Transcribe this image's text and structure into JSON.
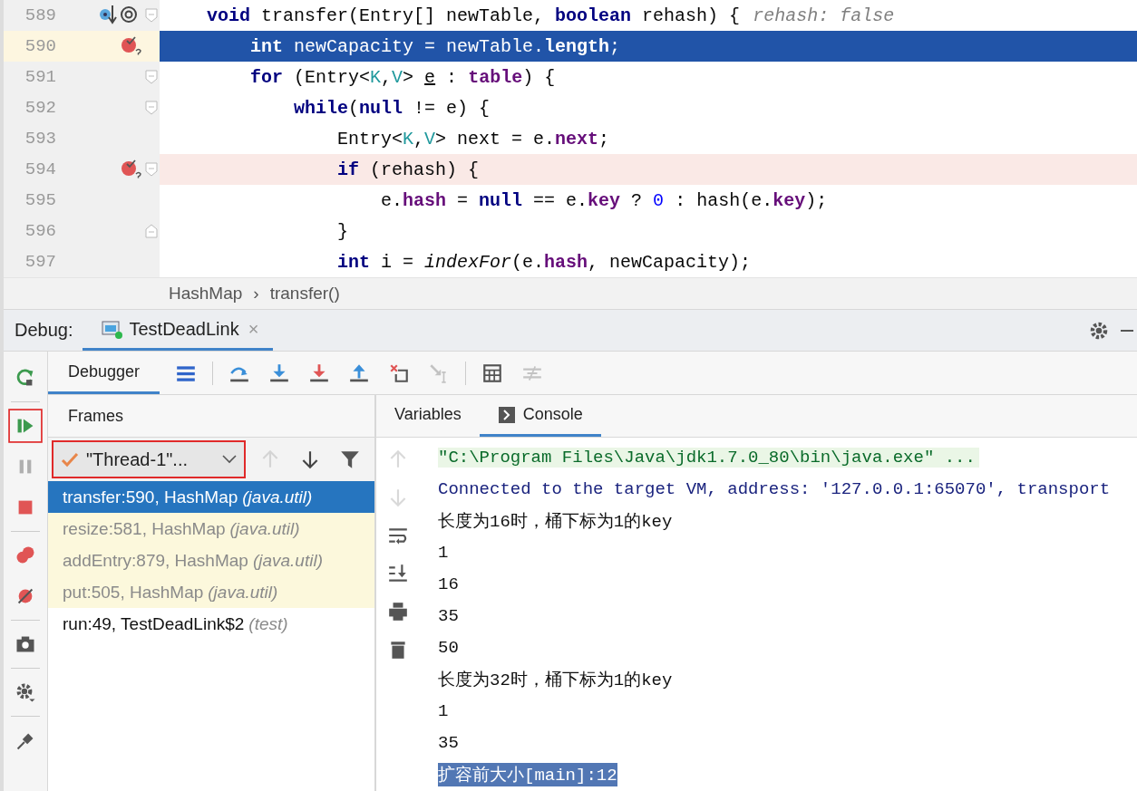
{
  "editor": {
    "lines": [
      {
        "number": "589",
        "kind": "plain",
        "breakpoint": false,
        "method_breakpoint": true,
        "fold_start": true,
        "fold_end": false,
        "tokens": [
          {
            "kind": "kw",
            "t": "void"
          },
          {
            "kind": "p",
            "t": " transfer(Entry[] newTable, "
          },
          {
            "kind": "kw",
            "t": "boolean"
          },
          {
            "kind": "p",
            "t": " rehash) {"
          },
          {
            "kind": "hint",
            "t": "rehash: false"
          }
        ],
        "children": [
          {
            "number": "590",
            "kind": "current",
            "breakpoint": true,
            "method_breakpoint": false,
            "fold_start": false,
            "fold_end": false,
            "tokens": [
              {
                "kind": "kw",
                "t": "int"
              },
              {
                "kind": "p",
                "t": " newCapacity = newTable."
              },
              {
                "kind": "fld",
                "t": "length"
              },
              {
                "kind": "p",
                "t": ";"
              }
            ]
          },
          {
            "number": "591",
            "kind": "plain",
            "breakpoint": false,
            "method_breakpoint": false,
            "fold_start": true,
            "fold_end": false,
            "tokens": [
              {
                "kind": "kw",
                "t": "for"
              },
              {
                "kind": "p",
                "t": " (Entry<"
              },
              {
                "kind": "tp",
                "t": "K"
              },
              {
                "kind": "p",
                "t": ","
              },
              {
                "kind": "tp",
                "t": "V"
              },
              {
                "kind": "p",
                "t": "> "
              },
              {
                "kind": "ul",
                "t": "e"
              },
              {
                "kind": "p",
                "t": " : "
              },
              {
                "kind": "fld",
                "t": "table"
              },
              {
                "kind": "p",
                "t": ") {"
              }
            ],
            "children": [
              {
                "number": "592",
                "kind": "plain",
                "breakpoint": false,
                "method_breakpoint": false,
                "fold_start": true,
                "fold_end": false,
                "tokens": [
                  {
                    "kind": "kw",
                    "t": "while"
                  },
                  {
                    "kind": "p",
                    "t": "("
                  },
                  {
                    "kind": "kw",
                    "t": "null"
                  },
                  {
                    "kind": "p",
                    "t": " != e) {"
                  }
                ],
                "children": [
                  {
                    "number": "593",
                    "kind": "plain",
                    "breakpoint": false,
                    "method_breakpoint": false,
                    "fold_start": false,
                    "fold_end": false,
                    "tokens": [
                      {
                        "kind": "p",
                        "t": "Entry<"
                      },
                      {
                        "kind": "tp",
                        "t": "K"
                      },
                      {
                        "kind": "p",
                        "t": ","
                      },
                      {
                        "kind": "tp",
                        "t": "V"
                      },
                      {
                        "kind": "p",
                        "t": "> next = e."
                      },
                      {
                        "kind": "fld",
                        "t": "next"
                      },
                      {
                        "kind": "p",
                        "t": ";"
                      }
                    ]
                  },
                  {
                    "number": "594",
                    "kind": "breakpoint",
                    "breakpoint": true,
                    "method_breakpoint": false,
                    "fold_start": true,
                    "fold_end": false,
                    "tokens": [
                      {
                        "kind": "kw",
                        "t": "if"
                      },
                      {
                        "kind": "p",
                        "t": " (rehash) {"
                      }
                    ],
                    "children": [
                      {
                        "number": "595",
                        "kind": "plain",
                        "breakpoint": false,
                        "method_breakpoint": false,
                        "fold_start": false,
                        "fold_end": false,
                        "tokens": [
                          {
                            "kind": "p",
                            "t": "e."
                          },
                          {
                            "kind": "fld",
                            "t": "hash"
                          },
                          {
                            "kind": "p",
                            "t": " = "
                          },
                          {
                            "kind": "kw",
                            "t": "null"
                          },
                          {
                            "kind": "p",
                            "t": " == e."
                          },
                          {
                            "kind": "fld",
                            "t": "key"
                          },
                          {
                            "kind": "p",
                            "t": " ? "
                          },
                          {
                            "kind": "num",
                            "t": "0"
                          },
                          {
                            "kind": "p",
                            "t": " : hash(e."
                          },
                          {
                            "kind": "fld",
                            "t": "key"
                          },
                          {
                            "kind": "p",
                            "t": ");"
                          }
                        ]
                      }
                    ]
                  },
                  {
                    "number": "596",
                    "kind": "plain",
                    "breakpoint": false,
                    "method_breakpoint": false,
                    "fold_start": false,
                    "fold_end": true,
                    "tokens": [
                      {
                        "kind": "p",
                        "t": "}"
                      }
                    ]
                  },
                  {
                    "number": "597",
                    "kind": "plain",
                    "breakpoint": false,
                    "method_breakpoint": false,
                    "fold_start": false,
                    "fold_end": false,
                    "tokens": [
                      {
                        "kind": "kw",
                        "t": "int"
                      },
                      {
                        "kind": "p",
                        "t": " i = "
                      },
                      {
                        "kind": "it",
                        "t": "indexFor"
                      },
                      {
                        "kind": "p",
                        "t": "(e."
                      },
                      {
                        "kind": "fld",
                        "t": "hash"
                      },
                      {
                        "kind": "p",
                        "t": ", newCapacity);"
                      }
                    ]
                  }
                ]
              }
            ]
          }
        ]
      }
    ]
  },
  "breadcrumb": [
    "HashMap",
    "›",
    "transfer()"
  ],
  "debug": {
    "label": "Debug:",
    "tab": {
      "title": "TestDeadLink",
      "close": "×"
    }
  },
  "side_toolbar": [
    {
      "kind": "rerun",
      "disabled": false,
      "marked": false
    },
    {
      "kind": "resume",
      "disabled": false,
      "marked": true
    },
    {
      "kind": "pause",
      "disabled": true,
      "marked": false
    },
    {
      "kind": "stop",
      "disabled": false,
      "marked": false
    },
    {
      "kind": "breakpoints",
      "disabled": false,
      "marked": false
    },
    {
      "kind": "mute",
      "disabled": false,
      "marked": false
    },
    {
      "kind": "camera",
      "disabled": false,
      "marked": false
    },
    {
      "kind": "settings",
      "disabled": false,
      "marked": false
    },
    {
      "kind": "pin",
      "disabled": false,
      "marked": false
    }
  ],
  "debugger_tab": {
    "label": "Debugger",
    "selected": true
  },
  "debugger_toolbar": [
    {
      "kind": "frames",
      "disabled": false
    },
    {
      "kind": "step-over",
      "disabled": false
    },
    {
      "kind": "step-into",
      "disabled": false
    },
    {
      "kind": "force-step-into",
      "disabled": false
    },
    {
      "kind": "step-out",
      "disabled": false
    },
    {
      "kind": "drop-frame",
      "disabled": false
    },
    {
      "kind": "run-to-cursor",
      "disabled": true
    },
    {
      "kind": "evaluate",
      "disabled": false
    },
    {
      "kind": "trace",
      "disabled": true
    }
  ],
  "frames": {
    "title": "Frames",
    "thread": {
      "value": "\"Thread-1\"...",
      "marked": true
    },
    "tools": [
      {
        "kind": "up",
        "disabled": true
      },
      {
        "kind": "down",
        "disabled": false
      },
      {
        "kind": "filter",
        "disabled": false
      }
    ],
    "items": [
      {
        "label": "transfer:590, HashMap",
        "package": "(java.util)",
        "selected": true,
        "library": true
      },
      {
        "label": "resize:581, HashMap",
        "package": "(java.util)",
        "selected": false,
        "library": true
      },
      {
        "label": "addEntry:879, HashMap",
        "package": "(java.util)",
        "selected": false,
        "library": true
      },
      {
        "label": "put:505, HashMap",
        "package": "(java.util)",
        "selected": false,
        "library": true
      },
      {
        "label": "run:49, TestDeadLink$2",
        "package": "(test)",
        "selected": false,
        "library": false
      }
    ]
  },
  "right_tabs": [
    {
      "label": "Variables",
      "selected": false
    },
    {
      "label": "Console",
      "selected": true
    }
  ],
  "console": {
    "tools": [
      {
        "kind": "up",
        "disabled": true
      },
      {
        "kind": "down",
        "disabled": true
      },
      {
        "kind": "soft-wrap",
        "disabled": false
      },
      {
        "kind": "scroll-end",
        "disabled": false
      },
      {
        "kind": "print",
        "disabled": false
      },
      {
        "kind": "trash",
        "disabled": false
      }
    ],
    "lines": [
      {
        "kind": "command",
        "text": "\"C:\\Program Files\\Java\\jdk1.7.0_80\\bin\\java.exe\" ...",
        "highlighted": false
      },
      {
        "kind": "system",
        "text": "Connected to the target VM, address: '127.0.0.1:65070', transport",
        "highlighted": false
      },
      {
        "kind": "output",
        "text": "长度为16时，桶下标为1的key",
        "highlighted": false
      },
      {
        "kind": "output",
        "text": "1",
        "highlighted": false
      },
      {
        "kind": "output",
        "text": "16",
        "highlighted": false
      },
      {
        "kind": "output",
        "text": "35",
        "highlighted": false
      },
      {
        "kind": "output",
        "text": "50",
        "highlighted": false
      },
      {
        "kind": "output",
        "text": "长度为32时，桶下标为1的key",
        "highlighted": false
      },
      {
        "kind": "output",
        "text": "1",
        "highlighted": false
      },
      {
        "kind": "output",
        "text": "35",
        "highlighted": false
      },
      {
        "kind": "output",
        "text": "扩容前大小[main]:12",
        "highlighted": true
      }
    ]
  }
}
